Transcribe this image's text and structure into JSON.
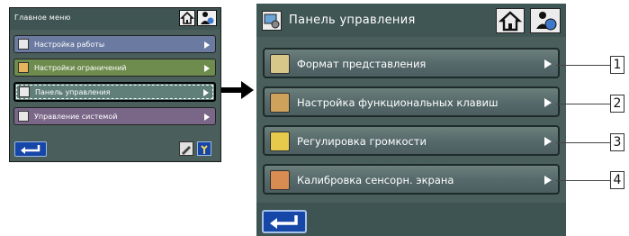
{
  "small_screen": {
    "title": "Главное меню",
    "items": [
      {
        "label": "Настройка работы",
        "color": "#6a7aa0"
      },
      {
        "label": "Настройки ограничений",
        "color": "#6f8c4f"
      },
      {
        "label": "Панель управления",
        "color": "#5f7f78"
      },
      {
        "label": "Управление системой",
        "color": "#7a6788"
      }
    ]
  },
  "big_screen": {
    "title": "Панель управления",
    "items": [
      {
        "label": "Формат представления"
      },
      {
        "label": "Настройка функциональных клавиш"
      },
      {
        "label": "Регулировка громкости"
      },
      {
        "label": "Калибровка сенсорн. экрана"
      }
    ]
  },
  "callouts": [
    "1",
    "2",
    "3",
    "4"
  ]
}
